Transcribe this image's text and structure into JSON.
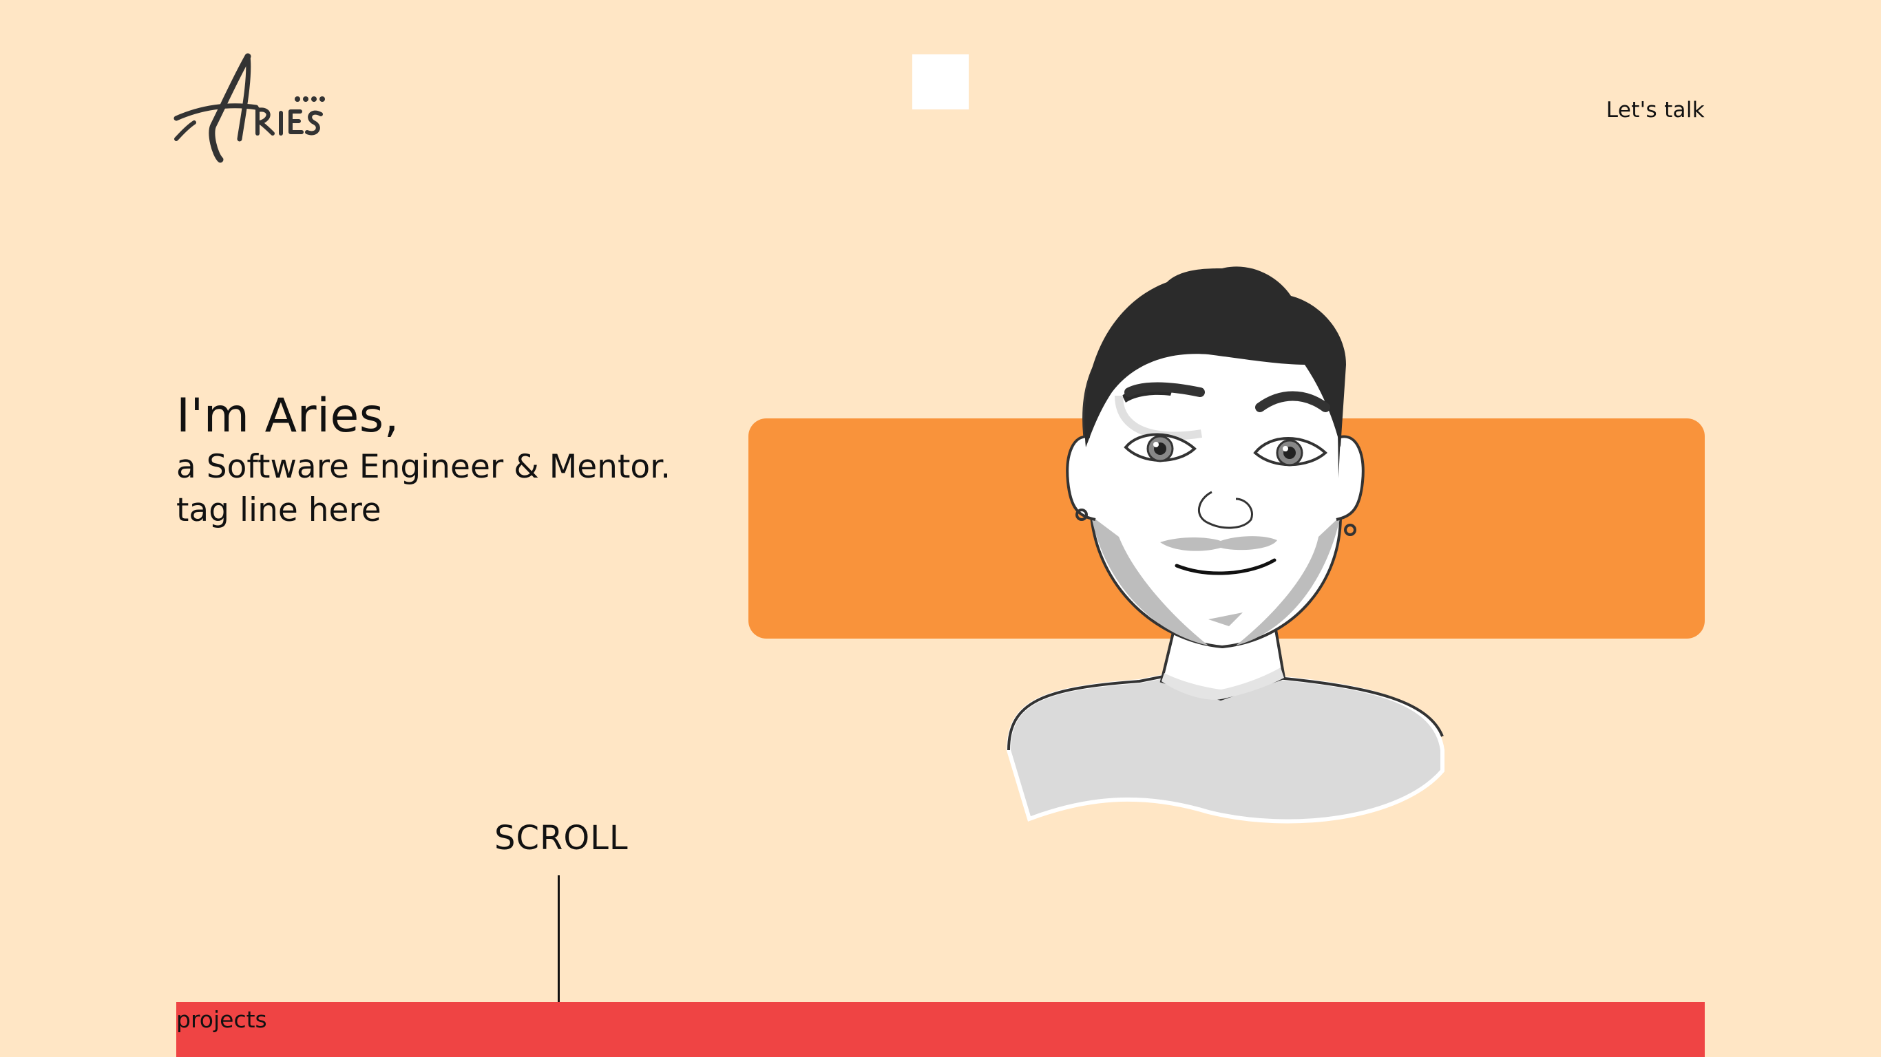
{
  "header": {
    "logo_text": "Aries",
    "nav_cta": "Let's talk"
  },
  "hero": {
    "greeting": "I'm Aries,",
    "role": "a Software Engineer & Mentor.",
    "tagline": "tag line here"
  },
  "scroll_hint": {
    "label": "SCROLL"
  },
  "sections": {
    "projects_label": "projects"
  },
  "colors": {
    "background": "#FFE6C5",
    "accent_orange": "#F9933B",
    "projects_red": "#EF4444",
    "text": "#111111"
  },
  "icons": {
    "logo": "aries-signature-logo",
    "avatar": "cartoon-avatar-illustration"
  }
}
